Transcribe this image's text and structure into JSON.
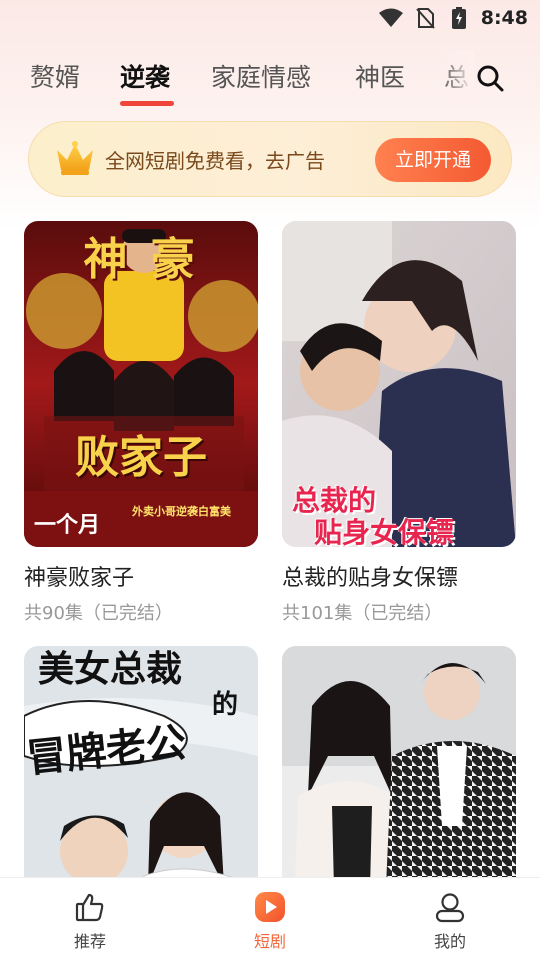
{
  "status_bar": {
    "time": "8:48"
  },
  "tabs": {
    "items": [
      {
        "label": "赘婿"
      },
      {
        "label": "逆袭"
      },
      {
        "label": "家庭情感"
      },
      {
        "label": "神医"
      },
      {
        "label": "总"
      }
    ],
    "active_index": 1
  },
  "banner": {
    "text": "全网短剧免费看，去广告",
    "cta_label": "立即开通"
  },
  "cards": [
    {
      "title": "神豪败家子",
      "subtitle": "共90集（已完结）",
      "poster_text": {
        "top": "神  豪",
        "middle": "败家子",
        "bottom": "一个月",
        "tag": "外卖小哥逆袭白富美"
      }
    },
    {
      "title": "总裁的贴身女保镖",
      "subtitle": "共101集（已完结）",
      "poster_text": {
        "line1": "总裁的",
        "line2": "贴身女保镖"
      }
    },
    {
      "title": "",
      "subtitle": "",
      "poster_text": {
        "line1": "美女总裁",
        "line2": "的",
        "line3": "冒牌老公"
      }
    },
    {
      "title": "",
      "subtitle": "",
      "poster_text": {}
    }
  ],
  "bottom_nav": {
    "items": [
      {
        "label": "推荐",
        "icon": "thumbs-up-icon"
      },
      {
        "label": "短剧",
        "icon": "play-icon"
      },
      {
        "label": "我的",
        "icon": "user-icon"
      }
    ],
    "active_index": 1
  },
  "colors": {
    "accent": "#f0453a",
    "active_nav": "#f4663b",
    "banner_text": "#7a4a1d"
  }
}
